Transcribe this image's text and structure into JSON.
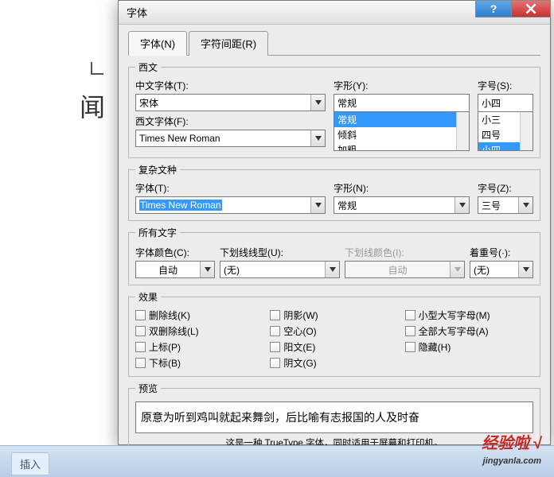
{
  "bg": {
    "text_fragment": "闻",
    "insert_tab": "插入"
  },
  "dialog": {
    "title": "字体",
    "tabs": {
      "font": "字体(N)",
      "spacing": "字符间距(R)",
      "font_acc": "N",
      "spacing_acc": "R"
    },
    "sections": {
      "western": "西文",
      "complex": "复杂文种",
      "allfonts": "所有文字",
      "effects": "效果",
      "preview": "预览"
    },
    "western": {
      "cn_font_label": "中文字体(T):",
      "cn_font_value": "宋体",
      "en_font_label": "西文字体(F):",
      "en_font_value": "Times New Roman",
      "style_label": "字形(Y):",
      "style_value": "常规",
      "style_options": [
        "常规",
        "倾斜",
        "加粗"
      ],
      "size_label": "字号(S):",
      "size_value": "小四",
      "size_options": [
        "小三",
        "四号",
        "小四"
      ]
    },
    "complex": {
      "font_label": "字体(T):",
      "font_value": "Times New Roman",
      "style_label": "字形(N):",
      "style_value": "常规",
      "size_label": "字号(Z):",
      "size_value": "三号"
    },
    "allfonts": {
      "color_label": "字体颜色(C):",
      "color_value": "自动",
      "underline_label": "下划线线型(U):",
      "underline_value": "(无)",
      "underline_color_label": "下划线颜色(I):",
      "underline_color_value": "自动",
      "emphasis_label": "着重号(·):",
      "emphasis_value": "(无)"
    },
    "effects": {
      "strike": "删除线(K)",
      "dblstrike": "双删除线(L)",
      "super": "上标(P)",
      "sub": "下标(B)",
      "shadow": "阴影(W)",
      "hollow": "空心(O)",
      "emboss": "阳文(E)",
      "engrave": "阴文(G)",
      "smallcaps": "小型大写字母(M)",
      "allcaps": "全部大写字母(A)",
      "hidden": "隐藏(H)"
    },
    "preview": {
      "text": "原意为听到鸡叫就起来舞剑，后比喻有志报国的人及时奋",
      "note": "这是一种 TrueType 字体，同时适用于屏幕和打印机。"
    }
  },
  "watermark": {
    "main": "经验啦",
    "check": "√",
    "sub": "jingyanla.com"
  }
}
